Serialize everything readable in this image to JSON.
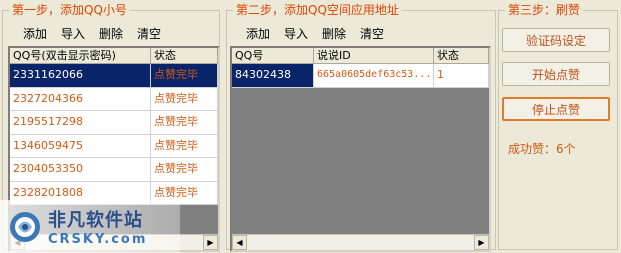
{
  "step1": {
    "title": "第一步，添加QQ小号",
    "toolbar": [
      "添加",
      "导入",
      "删除",
      "清空"
    ],
    "columns": [
      "QQ号(双击显示密码)",
      "状态"
    ],
    "rows": [
      {
        "qq": "2331162066",
        "status": "点赞完毕",
        "selected": true
      },
      {
        "qq": "2327204366",
        "status": "点赞完毕"
      },
      {
        "qq": "2195517298",
        "status": "点赞完毕"
      },
      {
        "qq": "1346059475",
        "status": "点赞完毕"
      },
      {
        "qq": "2304053350",
        "status": "点赞完毕"
      },
      {
        "qq": "2328201808",
        "status": "点赞完毕"
      }
    ]
  },
  "step2": {
    "title": "第二步，添加QQ空间应用地址",
    "toolbar": [
      "添加",
      "导入",
      "删除",
      "清空"
    ],
    "columns": [
      "QQ号",
      "说说ID",
      "状态"
    ],
    "rows": [
      {
        "qq": "84302438",
        "sid": "665a0605def63c53...",
        "status": "1",
        "selected": true
      }
    ]
  },
  "step3": {
    "title": "第三步：刷赞",
    "buttons": [
      "验证码设定",
      "开始点赞",
      "停止点赞"
    ],
    "success_text": "成功赞：6个"
  },
  "watermark": {
    "cn": "非凡软件站",
    "en": "CRSKY.com"
  },
  "colors": {
    "accent": "#e04400",
    "selection": "#0a246a",
    "window_bg": "#ece9d8"
  }
}
